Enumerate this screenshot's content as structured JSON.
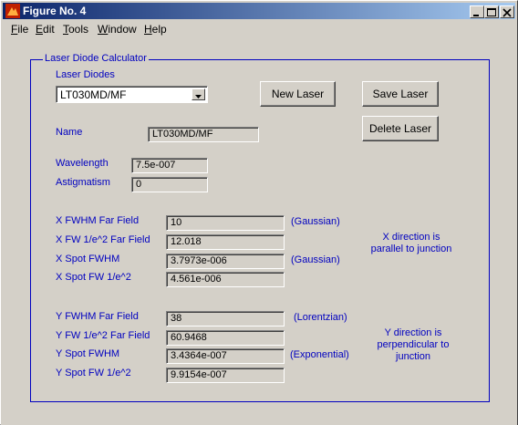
{
  "window": {
    "title": "Figure No. 4"
  },
  "menu": [
    {
      "label": "File",
      "underline": "F",
      "rest": "ile"
    },
    {
      "label": "Edit",
      "underline": "E",
      "rest": "dit"
    },
    {
      "label": "Tools",
      "underline": "T",
      "rest": "ools"
    },
    {
      "label": "Window",
      "underline": "W",
      "rest": "indow"
    },
    {
      "label": "Help",
      "underline": "H",
      "rest": "elp"
    }
  ],
  "panel": {
    "title": "Laser Diode Calculator"
  },
  "laser_diodes": {
    "label": "Laser Diodes",
    "selected": "LT030MD/MF"
  },
  "buttons": {
    "new_laser": "New Laser",
    "save_laser": "Save Laser",
    "delete_laser": "Delete Laser"
  },
  "name": {
    "label": "Name",
    "value": "LT030MD/MF"
  },
  "wavelength": {
    "label": "Wavelength",
    "value": "7.5e-007"
  },
  "astigmatism": {
    "label": "Astigmatism",
    "value": "0"
  },
  "x_rows": [
    {
      "label": "X FWHM Far Field",
      "value": "10",
      "note": "(Gaussian)"
    },
    {
      "label": "X FW 1/e^2 Far Field",
      "value": "12.018",
      "note": ""
    },
    {
      "label": "X Spot FWHM",
      "value": "3.7973e-006",
      "note": "(Gaussian)"
    },
    {
      "label": "X Spot FW 1/e^2",
      "value": "4.561e-006",
      "note": ""
    }
  ],
  "x_direction_note": [
    "X direction is",
    "parallel to junction"
  ],
  "y_rows": [
    {
      "label": "Y FWHM Far Field",
      "value": "38",
      "note": "(Lorentzian)"
    },
    {
      "label": "Y FW 1/e^2 Far Field",
      "value": "60.9468",
      "note": ""
    },
    {
      "label": "Y Spot FWHM",
      "value": "3.4364e-007",
      "note": "(Exponential)"
    },
    {
      "label": "Y Spot FW 1/e^2",
      "value": "9.9154e-007",
      "note": ""
    }
  ],
  "y_direction_note": [
    "Y direction is",
    "perpendicular to",
    "junction"
  ]
}
